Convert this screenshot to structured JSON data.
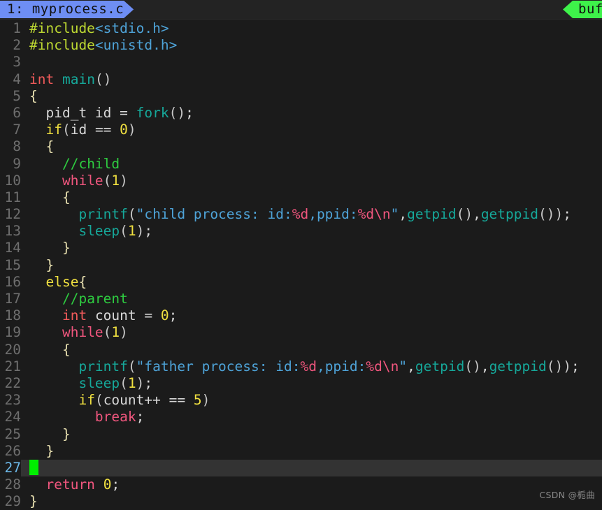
{
  "editor": {
    "theme_colors": {
      "background": "#1b1b1b",
      "tabbar_background": "#232323",
      "active_tab": "#6e8ef4",
      "buffers_tab": "#3ef24a",
      "current_line_highlight": "#333333",
      "cursor": "#00f000",
      "line_number": "#6e6e6e",
      "current_line_number": "#6cb8e8",
      "preprocessor": "#bdd832",
      "header_name": "#4ea3d8",
      "type_keyword": "#f05a5a",
      "function": "#16a89a",
      "conditional_keyword": "#f0e040",
      "control_keyword": "#f0567e",
      "number": "#f0e040",
      "string": "#4ea3d8",
      "escape": "#f0567e",
      "comment": "#2ecc40",
      "brace": "#e8e0b0",
      "identifier": "#d8d8d8"
    },
    "tabs": [
      {
        "label": "1: myprocess.c",
        "active": true
      },
      {
        "label": "buf",
        "active": false
      }
    ],
    "current_line": 27,
    "total_lines": 29,
    "watermark": "CSDN @栀曲",
    "lines": [
      {
        "n": "1",
        "tokens": [
          {
            "t": "#include",
            "c": "t-pre"
          },
          {
            "t": "<stdio.h>",
            "c": "t-header"
          }
        ]
      },
      {
        "n": "2",
        "tokens": [
          {
            "t": "#include",
            "c": "t-pre"
          },
          {
            "t": "<unistd.h>",
            "c": "t-header"
          }
        ]
      },
      {
        "n": "3",
        "tokens": []
      },
      {
        "n": "4",
        "tokens": [
          {
            "t": "int",
            "c": "t-type"
          },
          {
            "t": " ",
            "c": "t-plain"
          },
          {
            "t": "main",
            "c": "t-fn"
          },
          {
            "t": "()",
            "c": "t-paren"
          }
        ]
      },
      {
        "n": "5",
        "tokens": [
          {
            "t": "{",
            "c": "t-brace"
          }
        ]
      },
      {
        "n": "6",
        "tokens": [
          {
            "t": "  pid_t id ",
            "c": "t-plain"
          },
          {
            "t": "=",
            "c": "t-plain"
          },
          {
            "t": " ",
            "c": "t-plain"
          },
          {
            "t": "fork",
            "c": "t-fn"
          },
          {
            "t": "()",
            "c": "t-paren"
          },
          {
            "t": ";",
            "c": "t-plain"
          }
        ]
      },
      {
        "n": "7",
        "tokens": [
          {
            "t": "  ",
            "c": "t-plain"
          },
          {
            "t": "if",
            "c": "t-kw"
          },
          {
            "t": "(",
            "c": "t-paren"
          },
          {
            "t": "id == ",
            "c": "t-plain"
          },
          {
            "t": "0",
            "c": "t-num"
          },
          {
            "t": ")",
            "c": "t-paren"
          }
        ]
      },
      {
        "n": "8",
        "tokens": [
          {
            "t": "  ",
            "c": "t-plain"
          },
          {
            "t": "{",
            "c": "t-brace"
          }
        ]
      },
      {
        "n": "9",
        "tokens": [
          {
            "t": "    ",
            "c": "t-plain"
          },
          {
            "t": "//child",
            "c": "t-cmt"
          }
        ]
      },
      {
        "n": "10",
        "tokens": [
          {
            "t": "    ",
            "c": "t-plain"
          },
          {
            "t": "while",
            "c": "t-ctl"
          },
          {
            "t": "(",
            "c": "t-paren"
          },
          {
            "t": "1",
            "c": "t-num"
          },
          {
            "t": ")",
            "c": "t-paren"
          }
        ]
      },
      {
        "n": "11",
        "tokens": [
          {
            "t": "    ",
            "c": "t-plain"
          },
          {
            "t": "{",
            "c": "t-brace"
          }
        ]
      },
      {
        "n": "12",
        "tokens": [
          {
            "t": "      ",
            "c": "t-plain"
          },
          {
            "t": "printf",
            "c": "t-fn"
          },
          {
            "t": "(",
            "c": "t-paren"
          },
          {
            "t": "\"child process: id:",
            "c": "t-str"
          },
          {
            "t": "%d",
            "c": "t-esc"
          },
          {
            "t": ",ppid:",
            "c": "t-str"
          },
          {
            "t": "%d",
            "c": "t-esc"
          },
          {
            "t": "\\n",
            "c": "t-esc"
          },
          {
            "t": "\"",
            "c": "t-str"
          },
          {
            "t": ",",
            "c": "t-plain"
          },
          {
            "t": "getpid",
            "c": "t-fn"
          },
          {
            "t": "()",
            "c": "t-paren"
          },
          {
            "t": ",",
            "c": "t-plain"
          },
          {
            "t": "getppid",
            "c": "t-fn"
          },
          {
            "t": "())",
            "c": "t-paren"
          },
          {
            "t": ";",
            "c": "t-plain"
          }
        ]
      },
      {
        "n": "13",
        "tokens": [
          {
            "t": "      ",
            "c": "t-plain"
          },
          {
            "t": "sleep",
            "c": "t-fn"
          },
          {
            "t": "(",
            "c": "t-paren"
          },
          {
            "t": "1",
            "c": "t-num"
          },
          {
            "t": ")",
            "c": "t-paren"
          },
          {
            "t": ";",
            "c": "t-plain"
          }
        ]
      },
      {
        "n": "14",
        "tokens": [
          {
            "t": "    ",
            "c": "t-plain"
          },
          {
            "t": "}",
            "c": "t-brace"
          }
        ]
      },
      {
        "n": "15",
        "tokens": [
          {
            "t": "  ",
            "c": "t-plain"
          },
          {
            "t": "}",
            "c": "t-brace"
          }
        ]
      },
      {
        "n": "16",
        "tokens": [
          {
            "t": "  ",
            "c": "t-plain"
          },
          {
            "t": "else",
            "c": "t-kw"
          },
          {
            "t": "{",
            "c": "t-brace"
          }
        ]
      },
      {
        "n": "17",
        "tokens": [
          {
            "t": "    ",
            "c": "t-plain"
          },
          {
            "t": "//parent",
            "c": "t-cmt"
          }
        ]
      },
      {
        "n": "18",
        "tokens": [
          {
            "t": "    ",
            "c": "t-plain"
          },
          {
            "t": "int",
            "c": "t-type"
          },
          {
            "t": " count = ",
            "c": "t-plain"
          },
          {
            "t": "0",
            "c": "t-num"
          },
          {
            "t": ";",
            "c": "t-plain"
          }
        ]
      },
      {
        "n": "19",
        "tokens": [
          {
            "t": "    ",
            "c": "t-plain"
          },
          {
            "t": "while",
            "c": "t-ctl"
          },
          {
            "t": "(",
            "c": "t-paren"
          },
          {
            "t": "1",
            "c": "t-num"
          },
          {
            "t": ")",
            "c": "t-paren"
          }
        ]
      },
      {
        "n": "20",
        "tokens": [
          {
            "t": "    ",
            "c": "t-plain"
          },
          {
            "t": "{",
            "c": "t-brace"
          }
        ]
      },
      {
        "n": "21",
        "tokens": [
          {
            "t": "      ",
            "c": "t-plain"
          },
          {
            "t": "printf",
            "c": "t-fn"
          },
          {
            "t": "(",
            "c": "t-paren"
          },
          {
            "t": "\"father process: id:",
            "c": "t-str"
          },
          {
            "t": "%d",
            "c": "t-esc"
          },
          {
            "t": ",ppid:",
            "c": "t-str"
          },
          {
            "t": "%d",
            "c": "t-esc"
          },
          {
            "t": "\\n",
            "c": "t-esc"
          },
          {
            "t": "\"",
            "c": "t-str"
          },
          {
            "t": ",",
            "c": "t-plain"
          },
          {
            "t": "getpid",
            "c": "t-fn"
          },
          {
            "t": "()",
            "c": "t-paren"
          },
          {
            "t": ",",
            "c": "t-plain"
          },
          {
            "t": "getppid",
            "c": "t-fn"
          },
          {
            "t": "())",
            "c": "t-paren"
          },
          {
            "t": ";",
            "c": "t-plain"
          }
        ]
      },
      {
        "n": "22",
        "tokens": [
          {
            "t": "      ",
            "c": "t-plain"
          },
          {
            "t": "sleep",
            "c": "t-fn"
          },
          {
            "t": "(",
            "c": "t-paren"
          },
          {
            "t": "1",
            "c": "t-num"
          },
          {
            "t": ")",
            "c": "t-paren"
          },
          {
            "t": ";",
            "c": "t-plain"
          }
        ]
      },
      {
        "n": "23",
        "tokens": [
          {
            "t": "      ",
            "c": "t-plain"
          },
          {
            "t": "if",
            "c": "t-kw"
          },
          {
            "t": "(",
            "c": "t-paren"
          },
          {
            "t": "count++ == ",
            "c": "t-plain"
          },
          {
            "t": "5",
            "c": "t-num"
          },
          {
            "t": ")",
            "c": "t-paren"
          }
        ]
      },
      {
        "n": "24",
        "tokens": [
          {
            "t": "        ",
            "c": "t-plain"
          },
          {
            "t": "break",
            "c": "t-ctl"
          },
          {
            "t": ";",
            "c": "t-plain"
          }
        ]
      },
      {
        "n": "25",
        "tokens": [
          {
            "t": "    ",
            "c": "t-plain"
          },
          {
            "t": "}",
            "c": "t-brace"
          }
        ]
      },
      {
        "n": "26",
        "tokens": [
          {
            "t": "  ",
            "c": "t-plain"
          },
          {
            "t": "}",
            "c": "t-brace"
          }
        ]
      },
      {
        "n": "27",
        "tokens": [],
        "cursor": true,
        "current": true
      },
      {
        "n": "28",
        "tokens": [
          {
            "t": "  ",
            "c": "t-plain"
          },
          {
            "t": "return",
            "c": "t-ctl"
          },
          {
            "t": " ",
            "c": "t-plain"
          },
          {
            "t": "0",
            "c": "t-num"
          },
          {
            "t": ";",
            "c": "t-plain"
          }
        ]
      },
      {
        "n": "29",
        "tokens": [
          {
            "t": "}",
            "c": "t-brace"
          }
        ]
      }
    ]
  }
}
